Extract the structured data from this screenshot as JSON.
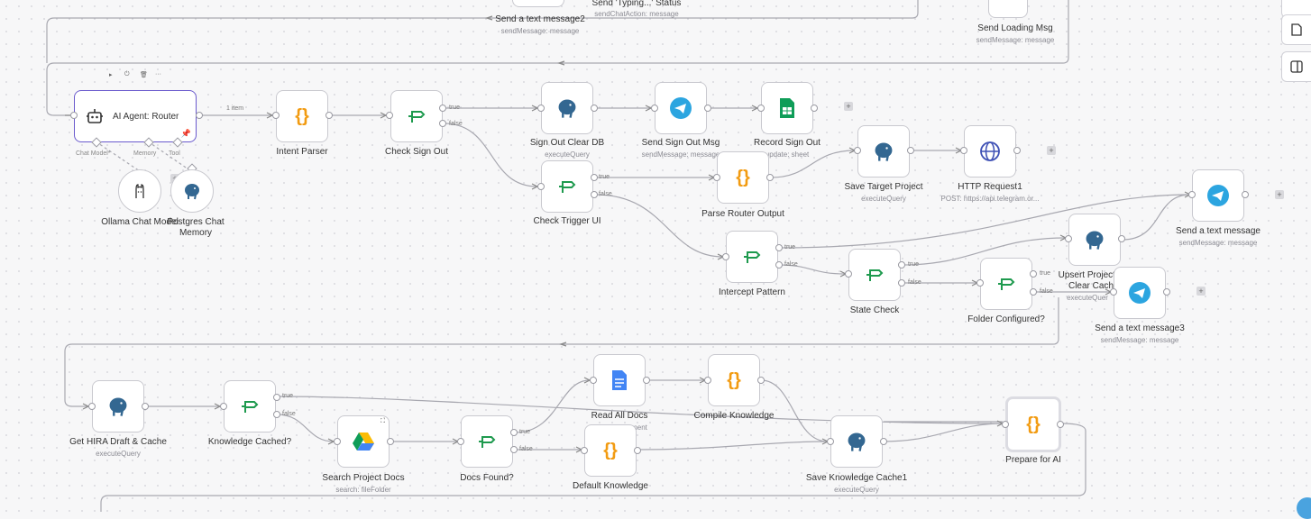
{
  "nodes": {
    "typing_status": {
      "name": "Send 'Typing...' Status",
      "sub": "sendChatAction: message"
    },
    "send_text2": {
      "name": "Send a text message2",
      "sub": "sendMessage: message"
    },
    "send_loading": {
      "name": "Send Loading Msg",
      "sub": "sendMessage: message"
    },
    "agent_router": {
      "name": "AI Agent: Router",
      "edge_label": "1 item",
      "ports": {
        "chat_model": "Chat Model*",
        "memory": "Memory",
        "tool": "Tool"
      }
    },
    "intent_parser": {
      "name": "Intent Parser"
    },
    "check_sign_out": {
      "name": "Check Sign Out"
    },
    "sign_out_clear_db": {
      "name": "Sign Out Clear DB",
      "sub": "executeQuery"
    },
    "send_sign_out_msg": {
      "name": "Send Sign Out Msg",
      "sub": "sendMessage: message"
    },
    "record_sign_out": {
      "name": "Record Sign Out",
      "sub": "update: sheet"
    },
    "ollama_chat_model": {
      "name": "Ollama Chat Model"
    },
    "postgres_chat_memory": {
      "name": "Postgres Chat Memory"
    },
    "check_trigger_ui": {
      "name": "Check Trigger UI"
    },
    "parse_router_output": {
      "name": "Parse Router Output"
    },
    "save_target_project": {
      "name": "Save Target Project",
      "sub": "executeQuery"
    },
    "http_request1": {
      "name": "HTTP Request1",
      "sub": "POST: https://api.telegram.or..."
    },
    "send_text": {
      "name": "Send a text message",
      "sub": "sendMessage: message"
    },
    "intercept_pattern": {
      "name": "Intercept Pattern"
    },
    "state_check": {
      "name": "State Check"
    },
    "folder_configured": {
      "name": "Folder Configured?"
    },
    "upsert_project": {
      "name": "Upsert Project S Clear Cach",
      "sub": "executeQuer"
    },
    "send_text3": {
      "name": "Send a text message3",
      "sub": "sendMessage: message"
    },
    "get_hira_draft": {
      "name": "Get HIRA Draft & Cache",
      "sub": "executeQuery"
    },
    "knowledge_cached": {
      "name": "Knowledge Cached?"
    },
    "search_project_docs": {
      "name": "Search Project Docs",
      "sub": "search: fileFolder"
    },
    "docs_found": {
      "name": "Docs Found?"
    },
    "read_all_docs": {
      "name": "Read All Docs",
      "sub": "ment"
    },
    "compile_knowledge": {
      "name": "Compile Knowledge"
    },
    "default_knowledge": {
      "name": "Default Knowledge"
    },
    "save_knowledge_cache1": {
      "name": "Save Knowledge Cache1",
      "sub": "executeQuery"
    },
    "prepare_for_ai": {
      "name": "Prepare for AI"
    }
  },
  "branches": {
    "true": "true",
    "false": "false"
  },
  "icons": {
    "postgres": "postgres-elephant-icon",
    "telegram": "telegram-icon",
    "sheets": "google-sheets-icon",
    "code": "code-braces-icon",
    "if": "if-branch-icon",
    "http": "globe-icon",
    "drive": "google-drive-icon",
    "docs": "google-docs-icon",
    "robot": "robot-icon",
    "ollama": "ollama-llama-icon"
  },
  "colors": {
    "code": "#f29b11",
    "if": "#1e9a4e",
    "telegram": "#2ca5e0",
    "postgres": "#336791",
    "sheets": "#0f9d58",
    "http": "#3f51b5",
    "agent_border": "#6a5acd"
  },
  "add_symbol": "+",
  "agent_toolbar": {
    "play": "▸",
    "power": "⏻",
    "delete": "🗑",
    "more": "···"
  },
  "side_toolbar": {
    "doc": "document-icon",
    "panel": "panel-icon"
  }
}
